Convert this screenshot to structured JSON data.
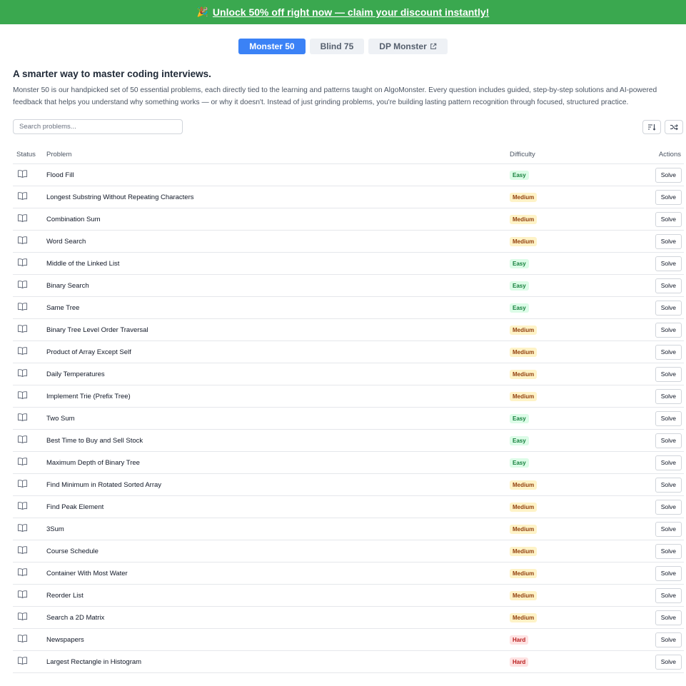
{
  "banner": {
    "emoji": "🎉",
    "text": "Unlock 50% off right now — claim your discount instantly!",
    "color": "#3aa84f"
  },
  "tabs": [
    {
      "label": "Monster 50",
      "active": true
    },
    {
      "label": "Blind 75",
      "active": false
    },
    {
      "label": "DP Monster",
      "active": false,
      "external": true
    }
  ],
  "intro": {
    "heading": "A smarter way to master coding interviews.",
    "body": "Monster 50 is our handpicked set of 50 essential problems, each directly tied to the learning and patterns taught on AlgoMonster. Every question includes guided, step-by-step solutions and AI-powered feedback that helps you understand why something works — or why it doesn't. Instead of just grinding problems, you're building lasting pattern recognition through focused, structured practice."
  },
  "search": {
    "placeholder": "Search problems..."
  },
  "toolbar": {
    "icons": [
      "sort-icon",
      "shuffle-icon"
    ]
  },
  "table": {
    "headers": {
      "status": "Status",
      "problem": "Problem",
      "difficulty": "Difficulty",
      "actions": "Actions"
    },
    "action_label": "Solve",
    "status_icon": "open-book-icon",
    "rows": [
      {
        "problem": "Flood Fill",
        "difficulty": "Easy"
      },
      {
        "problem": "Longest Substring Without Repeating Characters",
        "difficulty": "Medium"
      },
      {
        "problem": "Combination Sum",
        "difficulty": "Medium"
      },
      {
        "problem": "Word Search",
        "difficulty": "Medium"
      },
      {
        "problem": "Middle of the Linked List",
        "difficulty": "Easy"
      },
      {
        "problem": "Binary Search",
        "difficulty": "Easy"
      },
      {
        "problem": "Same Tree",
        "difficulty": "Easy"
      },
      {
        "problem": "Binary Tree Level Order Traversal",
        "difficulty": "Medium"
      },
      {
        "problem": "Product of Array Except Self",
        "difficulty": "Medium"
      },
      {
        "problem": "Daily Temperatures",
        "difficulty": "Medium"
      },
      {
        "problem": "Implement Trie (Prefix Tree)",
        "difficulty": "Medium"
      },
      {
        "problem": "Two Sum",
        "difficulty": "Easy"
      },
      {
        "problem": "Best Time to Buy and Sell Stock",
        "difficulty": "Easy"
      },
      {
        "problem": "Maximum Depth of Binary Tree",
        "difficulty": "Easy"
      },
      {
        "problem": "Find Minimum in Rotated Sorted Array",
        "difficulty": "Medium"
      },
      {
        "problem": "Find Peak Element",
        "difficulty": "Medium"
      },
      {
        "problem": "3Sum",
        "difficulty": "Medium"
      },
      {
        "problem": "Course Schedule",
        "difficulty": "Medium"
      },
      {
        "problem": "Container With Most Water",
        "difficulty": "Medium"
      },
      {
        "problem": "Reorder List",
        "difficulty": "Medium"
      },
      {
        "problem": "Search a 2D Matrix",
        "difficulty": "Medium"
      },
      {
        "problem": "Newspapers",
        "difficulty": "Hard"
      },
      {
        "problem": "Largest Rectangle in Histogram",
        "difficulty": "Hard"
      }
    ]
  },
  "colors": {
    "accent": "#3b82f6",
    "easy": "#15803d",
    "medium": "#92400e",
    "hard": "#b91c1c"
  }
}
